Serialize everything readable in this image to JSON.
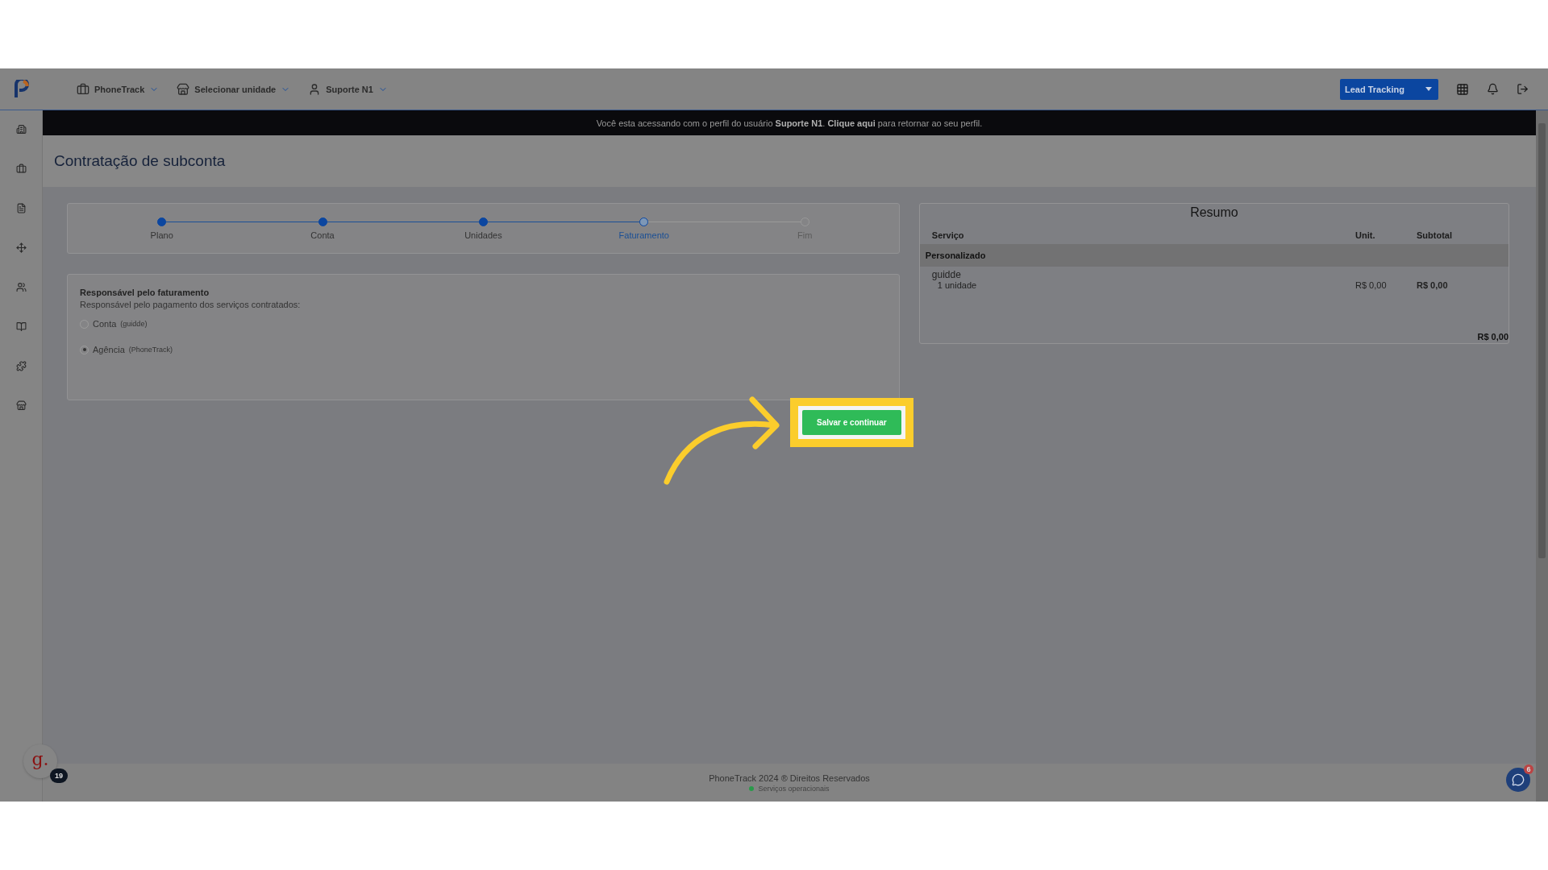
{
  "top_nav": {
    "items": [
      {
        "kind": "company",
        "label": "PhoneTrack"
      },
      {
        "kind": "unit",
        "label": "Selecionar unidade"
      },
      {
        "kind": "user",
        "label": "Suporte N1"
      }
    ],
    "product_switch": {
      "label": "Lead Tracking"
    }
  },
  "impersonation_banner": {
    "text": "Você esta acessando com o perfil do usuário **Suporte N1**. **Clique aqui** para retornar ao seu perfil."
  },
  "page_title": "Contratação de subconta",
  "stepper": {
    "steps": [
      {
        "label": "Plano",
        "completed": true,
        "selected": false
      },
      {
        "label": "Conta",
        "completed": true,
        "selected": false
      },
      {
        "label": "Unidades",
        "completed": true,
        "selected": false
      },
      {
        "label": "Faturamento",
        "completed": false,
        "selected": true
      },
      {
        "label": "Fim",
        "completed": false,
        "selected": false
      }
    ]
  },
  "billing": {
    "heading": "Responsável pelo faturamento",
    "subtitle": "Responsável pelo pagamento dos serviços contratados:",
    "options": [
      {
        "label": "Conta",
        "note": "(guidde)",
        "selected": false
      },
      {
        "label": "Agência",
        "note": "(PhoneTrack)",
        "selected": true
      }
    ]
  },
  "primary_button": {
    "label": "Salvar e continuar"
  },
  "summary": {
    "title": "Resumo",
    "columns": [
      "Serviço",
      "Unit.",
      "Subtotal"
    ],
    "groups": [
      {
        "name": "Personalizado",
        "items": [
          {
            "service": "guidde",
            "quantity": "1 unidade",
            "unit": "R$ 0,00",
            "subtotal": "R$ 0,00"
          }
        ]
      }
    ],
    "total": "R$ 0,00"
  },
  "footer": {
    "copyright": "PhoneTrack 2024 ® Direitos Reservados",
    "status": "Serviços operacionais"
  },
  "widgets": {
    "guidde_logo": "g.",
    "guidde_count": "19",
    "chat_count": "6"
  }
}
